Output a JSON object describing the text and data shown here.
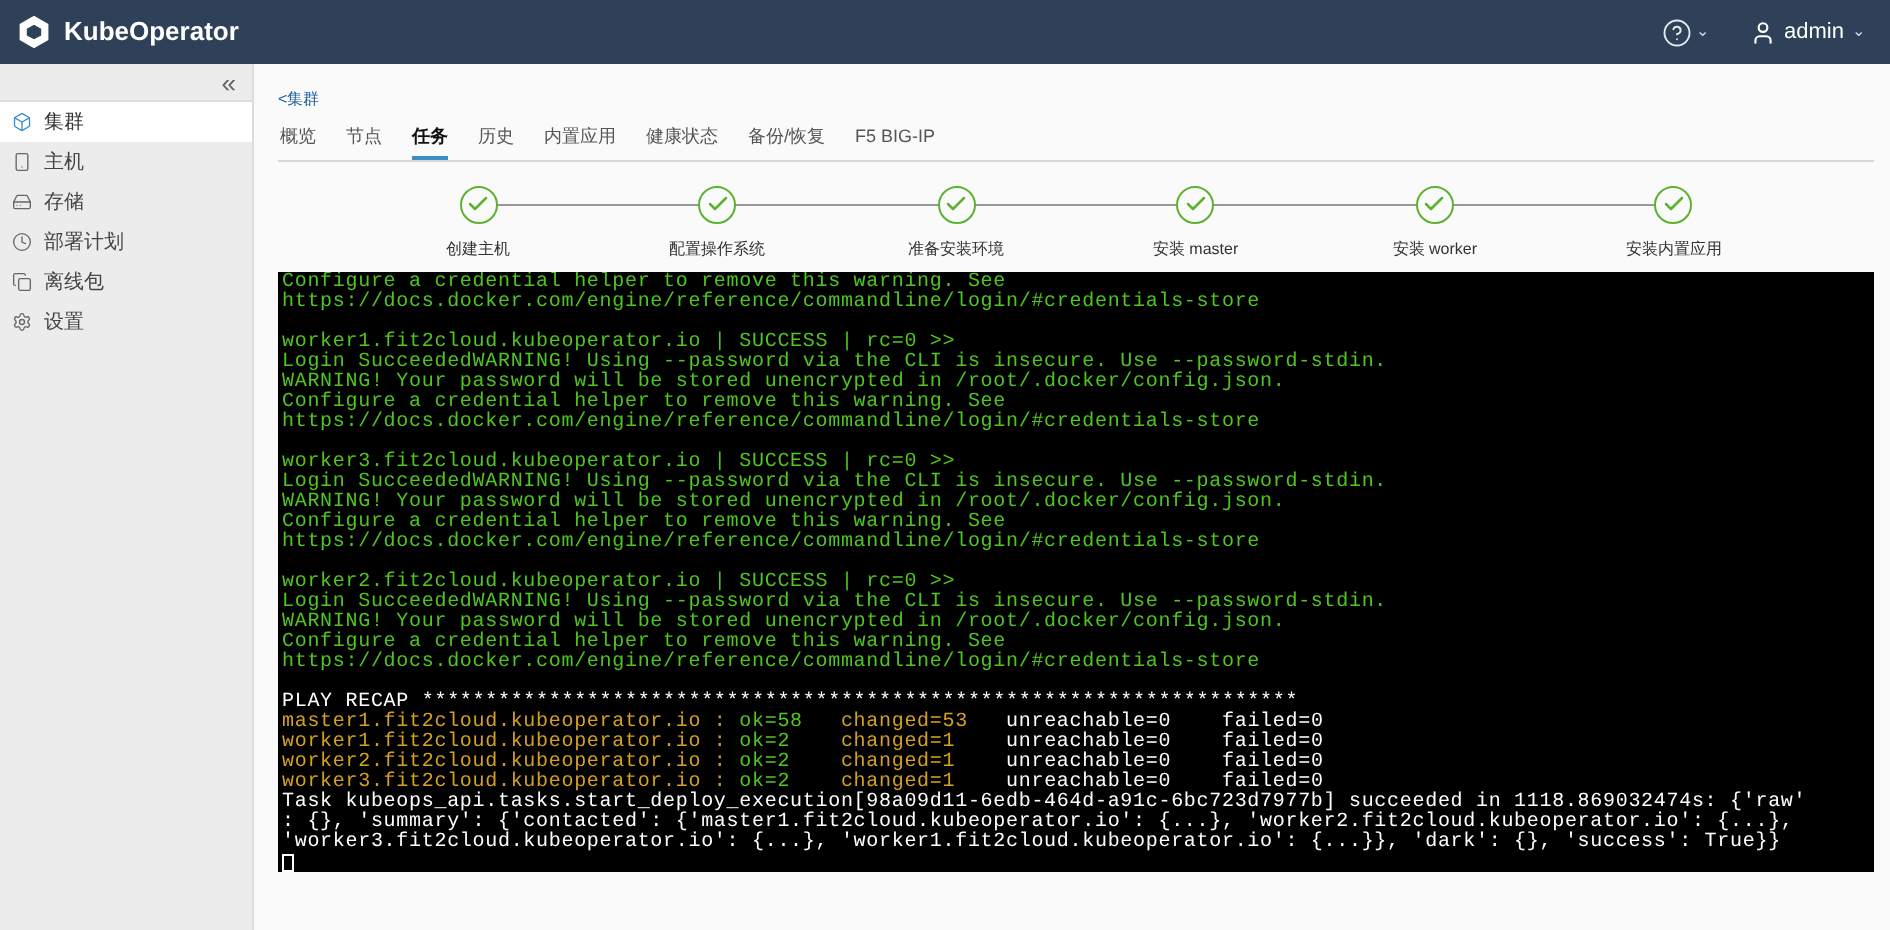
{
  "header": {
    "brand": "KubeOperator",
    "help_caret": "⌄",
    "user": "admin",
    "user_caret": "⌄"
  },
  "sidebar": {
    "collapse": "«",
    "items": [
      {
        "label": "集群",
        "selected": true
      },
      {
        "label": "主机",
        "selected": false
      },
      {
        "label": "存储",
        "selected": false
      },
      {
        "label": "部署计划",
        "selected": false
      },
      {
        "label": "离线包",
        "selected": false
      },
      {
        "label": "设置",
        "selected": false
      }
    ]
  },
  "breadcrumb": "<集群",
  "tabs": [
    {
      "label": "概览",
      "selected": false
    },
    {
      "label": "节点",
      "selected": false
    },
    {
      "label": "任务",
      "selected": true
    },
    {
      "label": "历史",
      "selected": false
    },
    {
      "label": "内置应用",
      "selected": false
    },
    {
      "label": "健康状态",
      "selected": false
    },
    {
      "label": "备份/恢复",
      "selected": false
    },
    {
      "label": "F5 BIG-IP",
      "selected": false
    }
  ],
  "steps": [
    {
      "label": "创建主机",
      "done": true
    },
    {
      "label": "配置操作系统",
      "done": true
    },
    {
      "label": "准备安装环境",
      "done": true
    },
    {
      "label": "安装 master",
      "done": true
    },
    {
      "label": "安装 worker",
      "done": true
    },
    {
      "label": "安装内置应用",
      "done": true
    }
  ],
  "terminal": {
    "lines": [
      {
        "kind": "text",
        "segments": [
          {
            "text": "Configure a credential helper to remove this warning. See",
            "color": "#4fc51f"
          }
        ]
      },
      {
        "kind": "text",
        "segments": [
          {
            "text": "https://docs.docker.com/engine/reference/commandline/login/#credentials-store",
            "color": "#4fc51f"
          }
        ]
      },
      {
        "kind": "blank"
      },
      {
        "kind": "text",
        "segments": [
          {
            "text": "worker1.fit2cloud.kubeoperator.io | SUCCESS | rc=0 >>",
            "color": "#4fc51f"
          }
        ]
      },
      {
        "kind": "text",
        "segments": [
          {
            "text": "Login SucceededWARNING! Using --password via the CLI is insecure. Use --password-stdin.",
            "color": "#4fc51f"
          }
        ]
      },
      {
        "kind": "text",
        "segments": [
          {
            "text": "WARNING! Your password will be stored unencrypted in /root/.docker/config.json.",
            "color": "#4fc51f"
          }
        ]
      },
      {
        "kind": "text",
        "segments": [
          {
            "text": "Configure a credential helper to remove this warning. See",
            "color": "#4fc51f"
          }
        ]
      },
      {
        "kind": "text",
        "segments": [
          {
            "text": "https://docs.docker.com/engine/reference/commandline/login/#credentials-store",
            "color": "#4fc51f"
          }
        ]
      },
      {
        "kind": "blank"
      },
      {
        "kind": "text",
        "segments": [
          {
            "text": "worker3.fit2cloud.kubeoperator.io | SUCCESS | rc=0 >>",
            "color": "#4fc51f"
          }
        ]
      },
      {
        "kind": "text",
        "segments": [
          {
            "text": "Login SucceededWARNING! Using --password via the CLI is insecure. Use --password-stdin.",
            "color": "#4fc51f"
          }
        ]
      },
      {
        "kind": "text",
        "segments": [
          {
            "text": "WARNING! Your password will be stored unencrypted in /root/.docker/config.json.",
            "color": "#4fc51f"
          }
        ]
      },
      {
        "kind": "text",
        "segments": [
          {
            "text": "Configure a credential helper to remove this warning. See",
            "color": "#4fc51f"
          }
        ]
      },
      {
        "kind": "text",
        "segments": [
          {
            "text": "https://docs.docker.com/engine/reference/commandline/login/#credentials-store",
            "color": "#4fc51f"
          }
        ]
      },
      {
        "kind": "blank"
      },
      {
        "kind": "text",
        "segments": [
          {
            "text": "worker2.fit2cloud.kubeoperator.io | SUCCESS | rc=0 >>",
            "color": "#4fc51f"
          }
        ]
      },
      {
        "kind": "text",
        "segments": [
          {
            "text": "Login SucceededWARNING! Using --password via the CLI is insecure. Use --password-stdin.",
            "color": "#4fc51f"
          }
        ]
      },
      {
        "kind": "text",
        "segments": [
          {
            "text": "WARNING! Your password will be stored unencrypted in /root/.docker/config.json.",
            "color": "#4fc51f"
          }
        ]
      },
      {
        "kind": "text",
        "segments": [
          {
            "text": "Configure a credential helper to remove this warning. See",
            "color": "#4fc51f"
          }
        ]
      },
      {
        "kind": "text",
        "segments": [
          {
            "text": "https://docs.docker.com/engine/reference/commandline/login/#credentials-store",
            "color": "#4fc51f"
          }
        ]
      },
      {
        "kind": "blank"
      },
      {
        "kind": "text",
        "segments": [
          {
            "text": "PLAY RECAP *********************************************************************",
            "color": "#ffffff"
          }
        ]
      },
      {
        "kind": "text",
        "segments": [
          {
            "text": "master1.fit2cloud.kubeoperator.io : ",
            "color": "#d4a020"
          },
          {
            "text": "ok=58 ",
            "color": "#4fc51f"
          },
          {
            "text": "  changed=53 ",
            "color": "#d4a020"
          },
          {
            "text": "  unreachable=0    failed=0",
            "color": "#ffffff"
          }
        ]
      },
      {
        "kind": "text",
        "segments": [
          {
            "text": "worker1.fit2cloud.kubeoperator.io : ",
            "color": "#d4a020"
          },
          {
            "text": "ok=2  ",
            "color": "#4fc51f"
          },
          {
            "text": "  changed=1  ",
            "color": "#d4a020"
          },
          {
            "text": "  unreachable=0    failed=0",
            "color": "#ffffff"
          }
        ]
      },
      {
        "kind": "text",
        "segments": [
          {
            "text": "worker2.fit2cloud.kubeoperator.io : ",
            "color": "#d4a020"
          },
          {
            "text": "ok=2  ",
            "color": "#4fc51f"
          },
          {
            "text": "  changed=1  ",
            "color": "#d4a020"
          },
          {
            "text": "  unreachable=0    failed=0",
            "color": "#ffffff"
          }
        ]
      },
      {
        "kind": "text",
        "segments": [
          {
            "text": "worker3.fit2cloud.kubeoperator.io : ",
            "color": "#d4a020"
          },
          {
            "text": "ok=2  ",
            "color": "#4fc51f"
          },
          {
            "text": "  changed=1  ",
            "color": "#d4a020"
          },
          {
            "text": "  unreachable=0    failed=0",
            "color": "#ffffff"
          }
        ]
      },
      {
        "kind": "text",
        "segments": [
          {
            "text": "Task kubeops_api.tasks.start_deploy_execution[98a09d11-6edb-464d-a91c-6bc723d7977b] succeeded in 1118.869032474s: {'raw'",
            "color": "#ffffff"
          }
        ]
      },
      {
        "kind": "text",
        "segments": [
          {
            "text": ": {}, 'summary': {'contacted': {'master1.fit2cloud.kubeoperator.io': {...}, 'worker2.fit2cloud.kubeoperator.io': {...},",
            "color": "#ffffff"
          }
        ]
      },
      {
        "kind": "text",
        "segments": [
          {
            "text": "'worker3.fit2cloud.kubeoperator.io': {...}, 'worker1.fit2cloud.kubeoperator.io': {...}}, 'dark': {}, 'success': True}}",
            "color": "#ffffff"
          }
        ]
      },
      {
        "kind": "cursor"
      }
    ]
  }
}
